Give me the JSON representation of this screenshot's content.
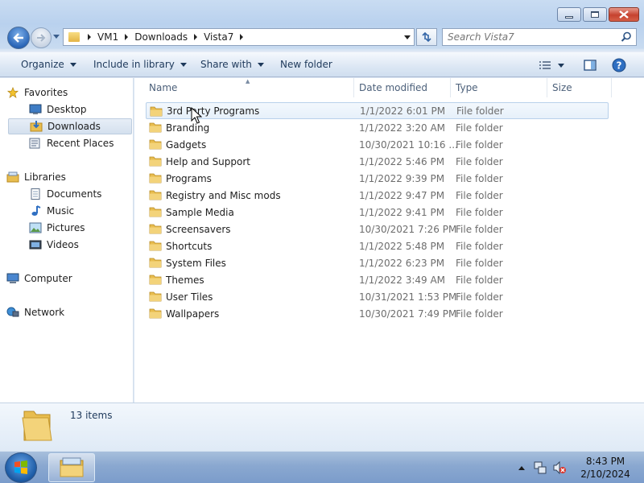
{
  "window": {
    "title_buttons": {
      "minimize": "minimize",
      "maximize": "maximize",
      "close": "close"
    }
  },
  "address": {
    "crumbs": [
      "VM1",
      "Downloads",
      "Vista7"
    ]
  },
  "search": {
    "placeholder": "Search Vista7"
  },
  "toolbar": {
    "organize": "Organize",
    "include": "Include in library",
    "share": "Share with",
    "new_folder": "New folder"
  },
  "sidebar": {
    "favorites": {
      "header": "Favorites",
      "items": [
        "Desktop",
        "Downloads",
        "Recent Places"
      ]
    },
    "libraries": {
      "header": "Libraries",
      "items": [
        "Documents",
        "Music",
        "Pictures",
        "Videos"
      ]
    },
    "computer": "Computer",
    "network": "Network",
    "selected": "Downloads"
  },
  "columns": {
    "name": "Name",
    "date": "Date modified",
    "type": "Type",
    "size": "Size"
  },
  "files": [
    {
      "name": "3rd Party Programs",
      "date": "1/1/2022 6:01 PM",
      "type": "File folder"
    },
    {
      "name": "Branding",
      "date": "1/1/2022 3:20 AM",
      "type": "File folder"
    },
    {
      "name": "Gadgets",
      "date": "10/30/2021 10:16 ...",
      "type": "File folder"
    },
    {
      "name": "Help and Support",
      "date": "1/1/2022 5:46 PM",
      "type": "File folder"
    },
    {
      "name": "Programs",
      "date": "1/1/2022 9:39 PM",
      "type": "File folder"
    },
    {
      "name": "Registry and Misc mods",
      "date": "1/1/2022 9:47 PM",
      "type": "File folder"
    },
    {
      "name": "Sample Media",
      "date": "1/1/2022 9:41 PM",
      "type": "File folder"
    },
    {
      "name": "Screensavers",
      "date": "10/30/2021 7:26 PM",
      "type": "File folder"
    },
    {
      "name": "Shortcuts",
      "date": "1/1/2022 5:48 PM",
      "type": "File folder"
    },
    {
      "name": "System Files",
      "date": "1/1/2022 6:23 PM",
      "type": "File folder"
    },
    {
      "name": "Themes",
      "date": "1/1/2022 3:49 AM",
      "type": "File folder"
    },
    {
      "name": "User Tiles",
      "date": "10/31/2021 1:53 PM",
      "type": "File folder"
    },
    {
      "name": "Wallpapers",
      "date": "10/30/2021 7:49 PM",
      "type": "File folder"
    }
  ],
  "details": {
    "count": "13 items"
  },
  "taskbar": {
    "time": "8:43 PM",
    "date": "2/10/2024"
  },
  "colors": {
    "folder": "#e8bd4f",
    "accent": "#1e395b",
    "selection": "#d4e0ee"
  }
}
